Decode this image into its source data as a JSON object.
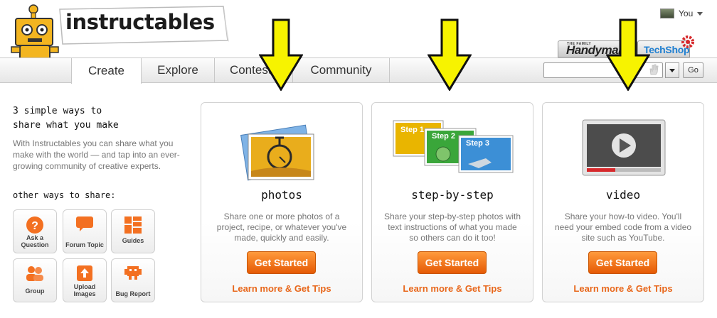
{
  "brand": {
    "logo_text": "instructables"
  },
  "user": {
    "name": "You"
  },
  "partners": {
    "handyman_pre": "THE FAMILY",
    "handyman": "Handyman",
    "techshop": "TechShop"
  },
  "nav": {
    "tabs": [
      "Create",
      "Explore",
      "Contests",
      "Community"
    ],
    "active": "Create"
  },
  "search": {
    "value": "",
    "go_label": "Go"
  },
  "sidebar": {
    "title_line1": "3 simple ways to",
    "title_line2": "share what you make",
    "description": "With Instructables you can share what you make with the world — and tap into an ever-growing community of creative experts.",
    "other_label": "other ways to share:",
    "buttons": [
      {
        "label": "Ask a Question",
        "icon": "question-icon"
      },
      {
        "label": "Forum Topic",
        "icon": "speech-bubble-icon"
      },
      {
        "label": "Guides",
        "icon": "grid-icon"
      },
      {
        "label": "Group",
        "icon": "people-icon"
      },
      {
        "label": "Upload Images",
        "icon": "upload-icon"
      },
      {
        "label": "Bug Report",
        "icon": "bug-icon"
      }
    ]
  },
  "cards": [
    {
      "title": "photos",
      "description": "Share one or more photos of a project, recipe, or whatever you've made, quickly and easily.",
      "button": "Get Started",
      "link": "Learn more & Get Tips"
    },
    {
      "title": "step-by-step",
      "description": "Share your step-by-step photos with text instructions of what you made so others can do it too!",
      "button": "Get Started",
      "link": "Learn more & Get Tips",
      "steps": [
        "Step 1",
        "Step 2",
        "Step 3"
      ]
    },
    {
      "title": "video",
      "description": "Share your how-to video. You'll need your embed code from a video site such as YouTube.",
      "button": "Get Started",
      "link": "Learn more & Get Tips"
    }
  ],
  "colors": {
    "accent_orange": "#e8671b",
    "arrow_yellow": "#f7f300",
    "step_blue": "#3c8fd6",
    "step_green": "#3aa63a",
    "step_yellow": "#f0c000"
  }
}
